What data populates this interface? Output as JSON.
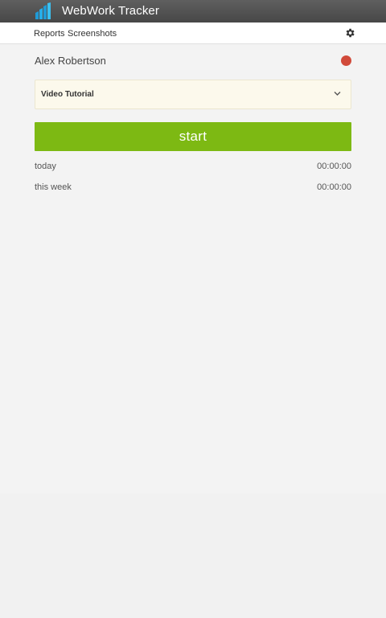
{
  "app": {
    "title": "WebWork Tracker",
    "logo_icon": "webwork-logo-icon",
    "colors": {
      "titlebar": "#4f4f4f",
      "accent_green": "#7db913",
      "status_red": "#d14a3a",
      "select_bg": "#fcf9ec"
    }
  },
  "nav": {
    "reports_label": "Reports",
    "screenshots_label": "Screenshots",
    "settings_icon": "gear-icon"
  },
  "user": {
    "name": "Alex Robertson",
    "status": "offline"
  },
  "project": {
    "selected": "Video Tutorial"
  },
  "timer": {
    "start_label": "start"
  },
  "stats": {
    "today_label": "today",
    "today_value": "00:00:00",
    "week_label": "this week",
    "week_value": "00:00:00"
  }
}
